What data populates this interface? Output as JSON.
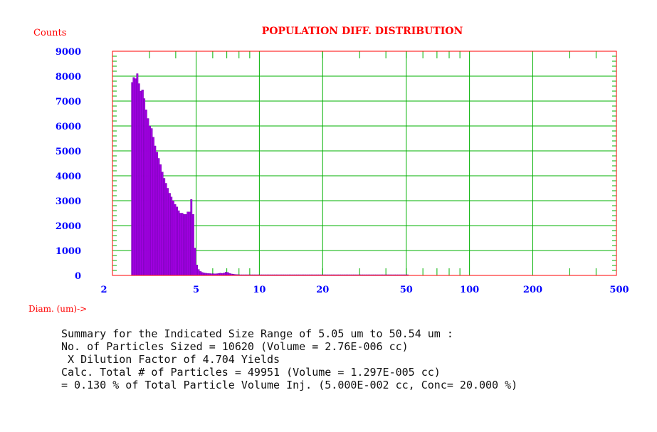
{
  "chart_data": {
    "type": "bar",
    "title": "POPULATION DIFF. DISTRIBUTION",
    "ylabel": "Counts",
    "xlabel": "Diam. (um)->",
    "x_scale": "log",
    "xlim": [
      2,
      500
    ],
    "ylim": [
      0,
      9000
    ],
    "x_ticks": [
      "2",
      "5",
      "10",
      "20",
      "50",
      "100",
      "200",
      "500"
    ],
    "y_ticks": [
      "9000",
      "8000",
      "7000",
      "6000",
      "5000",
      "4000",
      "3000",
      "2000",
      "1000",
      "0"
    ],
    "grid": true,
    "bars": [
      {
        "x": 2.46,
        "y": 7750
      },
      {
        "x": 2.5,
        "y": 7950
      },
      {
        "x": 2.55,
        "y": 7900
      },
      {
        "x": 2.6,
        "y": 8100
      },
      {
        "x": 2.65,
        "y": 7700
      },
      {
        "x": 2.7,
        "y": 7400
      },
      {
        "x": 2.75,
        "y": 7450
      },
      {
        "x": 2.81,
        "y": 7100
      },
      {
        "x": 2.86,
        "y": 6650
      },
      {
        "x": 2.92,
        "y": 6300
      },
      {
        "x": 2.98,
        "y": 6000
      },
      {
        "x": 3.04,
        "y": 5900
      },
      {
        "x": 3.1,
        "y": 5550
      },
      {
        "x": 3.16,
        "y": 5200
      },
      {
        "x": 3.22,
        "y": 4950
      },
      {
        "x": 3.29,
        "y": 4700
      },
      {
        "x": 3.35,
        "y": 4450
      },
      {
        "x": 3.42,
        "y": 4150
      },
      {
        "x": 3.49,
        "y": 3900
      },
      {
        "x": 3.56,
        "y": 3700
      },
      {
        "x": 3.63,
        "y": 3500
      },
      {
        "x": 3.7,
        "y": 3300
      },
      {
        "x": 3.78,
        "y": 3150
      },
      {
        "x": 3.85,
        "y": 3000
      },
      {
        "x": 3.93,
        "y": 2850
      },
      {
        "x": 4.01,
        "y": 2750
      },
      {
        "x": 4.09,
        "y": 2600
      },
      {
        "x": 4.17,
        "y": 2500
      },
      {
        "x": 4.25,
        "y": 2500
      },
      {
        "x": 4.34,
        "y": 2450
      },
      {
        "x": 4.43,
        "y": 2450
      },
      {
        "x": 4.52,
        "y": 2550
      },
      {
        "x": 4.61,
        "y": 2550
      },
      {
        "x": 4.7,
        "y": 3050
      },
      {
        "x": 4.79,
        "y": 2450
      },
      {
        "x": 4.89,
        "y": 1100
      },
      {
        "x": 4.99,
        "y": 420
      },
      {
        "x": 5.09,
        "y": 240
      },
      {
        "x": 5.19,
        "y": 160
      },
      {
        "x": 5.3,
        "y": 120
      },
      {
        "x": 5.4,
        "y": 100
      },
      {
        "x": 5.51,
        "y": 90
      },
      {
        "x": 5.62,
        "y": 80
      },
      {
        "x": 5.74,
        "y": 75
      },
      {
        "x": 5.85,
        "y": 70
      },
      {
        "x": 5.97,
        "y": 70
      },
      {
        "x": 6.09,
        "y": 65
      },
      {
        "x": 6.21,
        "y": 70
      },
      {
        "x": 6.34,
        "y": 80
      },
      {
        "x": 6.47,
        "y": 90
      },
      {
        "x": 6.6,
        "y": 80
      },
      {
        "x": 6.73,
        "y": 100
      },
      {
        "x": 6.87,
        "y": 130
      },
      {
        "x": 7.0,
        "y": 120
      },
      {
        "x": 7.15,
        "y": 80
      },
      {
        "x": 7.29,
        "y": 60
      },
      {
        "x": 7.44,
        "y": 50
      },
      {
        "x": 7.59,
        "y": 40
      },
      {
        "x": 7.74,
        "y": 35
      },
      {
        "x": 7.9,
        "y": 30
      },
      {
        "x": 8.06,
        "y": 25
      },
      {
        "x": 8.22,
        "y": 20
      },
      {
        "x": 8.39,
        "y": 20
      },
      {
        "x": 8.55,
        "y": 15
      },
      {
        "x": 8.73,
        "y": 15
      },
      {
        "x": 8.9,
        "y": 10
      },
      {
        "x": 9.08,
        "y": 10
      },
      {
        "x": 9.27,
        "y": 10
      },
      {
        "x": 9.45,
        "y": 8
      },
      {
        "x": 9.65,
        "y": 8
      },
      {
        "x": 9.84,
        "y": 6
      },
      {
        "x": 10.04,
        "y": 6
      },
      {
        "x": 10.25,
        "y": 5
      },
      {
        "x": 10.45,
        "y": 5
      },
      {
        "x": 10.67,
        "y": 4
      },
      {
        "x": 10.88,
        "y": 4
      },
      {
        "x": 11.11,
        "y": 3
      },
      {
        "x": 11.33,
        "y": 3
      },
      {
        "x": 11.56,
        "y": 3
      },
      {
        "x": 11.8,
        "y": 2
      },
      {
        "x": 12.04,
        "y": 2
      },
      {
        "x": 12.28,
        "y": 2
      },
      {
        "x": 12.53,
        "y": 2
      },
      {
        "x": 12.79,
        "y": 2
      },
      {
        "x": 13.05,
        "y": 1
      },
      {
        "x": 13.31,
        "y": 1
      },
      {
        "x": 13.58,
        "y": 1
      },
      {
        "x": 13.86,
        "y": 1
      },
      {
        "x": 14.14,
        "y": 1
      },
      {
        "x": 14.43,
        "y": 1
      },
      {
        "x": 14.72,
        "y": 1
      },
      {
        "x": 15.02,
        "y": 1
      },
      {
        "x": 15.33,
        "y": 1
      },
      {
        "x": 15.64,
        "y": 1
      },
      {
        "x": 15.96,
        "y": 1
      },
      {
        "x": 16.28,
        "y": 1
      },
      {
        "x": 16.61,
        "y": 1
      },
      {
        "x": 16.95,
        "y": 1
      },
      {
        "x": 17.29,
        "y": 1
      },
      {
        "x": 17.64,
        "y": 1
      },
      {
        "x": 18.0,
        "y": 1
      },
      {
        "x": 18.37,
        "y": 1
      },
      {
        "x": 18.74,
        "y": 1
      },
      {
        "x": 19.12,
        "y": 1
      },
      {
        "x": 19.51,
        "y": 1
      },
      {
        "x": 19.91,
        "y": 1
      },
      {
        "x": 20.31,
        "y": 1
      },
      {
        "x": 20.72,
        "y": 1
      },
      {
        "x": 21.14,
        "y": 1
      },
      {
        "x": 21.57,
        "y": 1
      },
      {
        "x": 22.01,
        "y": 1
      },
      {
        "x": 22.46,
        "y": 1
      },
      {
        "x": 22.91,
        "y": 1
      },
      {
        "x": 23.38,
        "y": 1
      },
      {
        "x": 23.86,
        "y": 1
      },
      {
        "x": 24.34,
        "y": 1
      },
      {
        "x": 24.84,
        "y": 1
      },
      {
        "x": 25.34,
        "y": 1
      },
      {
        "x": 25.85,
        "y": 1
      },
      {
        "x": 26.38,
        "y": 1
      },
      {
        "x": 26.91,
        "y": 1
      },
      {
        "x": 27.46,
        "y": 1
      },
      {
        "x": 28.02,
        "y": 1
      },
      {
        "x": 28.59,
        "y": 1
      },
      {
        "x": 29.17,
        "y": 1
      },
      {
        "x": 29.76,
        "y": 1
      },
      {
        "x": 30.37,
        "y": 1
      },
      {
        "x": 30.98,
        "y": 1
      },
      {
        "x": 31.61,
        "y": 1
      },
      {
        "x": 32.26,
        "y": 1
      },
      {
        "x": 32.91,
        "y": 1
      },
      {
        "x": 33.58,
        "y": 1
      },
      {
        "x": 34.26,
        "y": 1
      },
      {
        "x": 34.96,
        "y": 1
      },
      {
        "x": 35.67,
        "y": 1
      },
      {
        "x": 36.39,
        "y": 1
      },
      {
        "x": 37.13,
        "y": 1
      },
      {
        "x": 37.89,
        "y": 1
      },
      {
        "x": 38.66,
        "y": 1
      },
      {
        "x": 39.44,
        "y": 1
      },
      {
        "x": 40.24,
        "y": 1
      },
      {
        "x": 41.06,
        "y": 1
      },
      {
        "x": 41.89,
        "y": 1
      },
      {
        "x": 42.75,
        "y": 1
      },
      {
        "x": 43.61,
        "y": 1
      },
      {
        "x": 44.5,
        "y": 1
      },
      {
        "x": 45.4,
        "y": 1
      },
      {
        "x": 46.33,
        "y": 1
      },
      {
        "x": 47.27,
        "y": 1
      },
      {
        "x": 48.23,
        "y": 1
      },
      {
        "x": 49.21,
        "y": 1
      },
      {
        "x": 50.21,
        "y": 1
      }
    ],
    "colors": {
      "bars": "#a000e0",
      "bar_outline": "#6a00a8",
      "grid": "#00b000",
      "frame": "#ff0000",
      "axis_text": "#0000ff",
      "title": "#ff0000"
    }
  },
  "summary": {
    "line1": "Summary for the Indicated Size Range of 5.05 um to 50.54 um :",
    "line2": "No. of Particles Sized = 10620 (Volume = 2.76E-006 cc)",
    "line3": " X Dilution Factor of 4.704 Yields",
    "line4": "Calc. Total # of Particles = 49951 (Volume = 1.297E-005 cc)",
    "line5": "= 0.130 % of Total Particle Volume Inj. (5.000E-002 cc, Conc= 20.000 %)"
  }
}
